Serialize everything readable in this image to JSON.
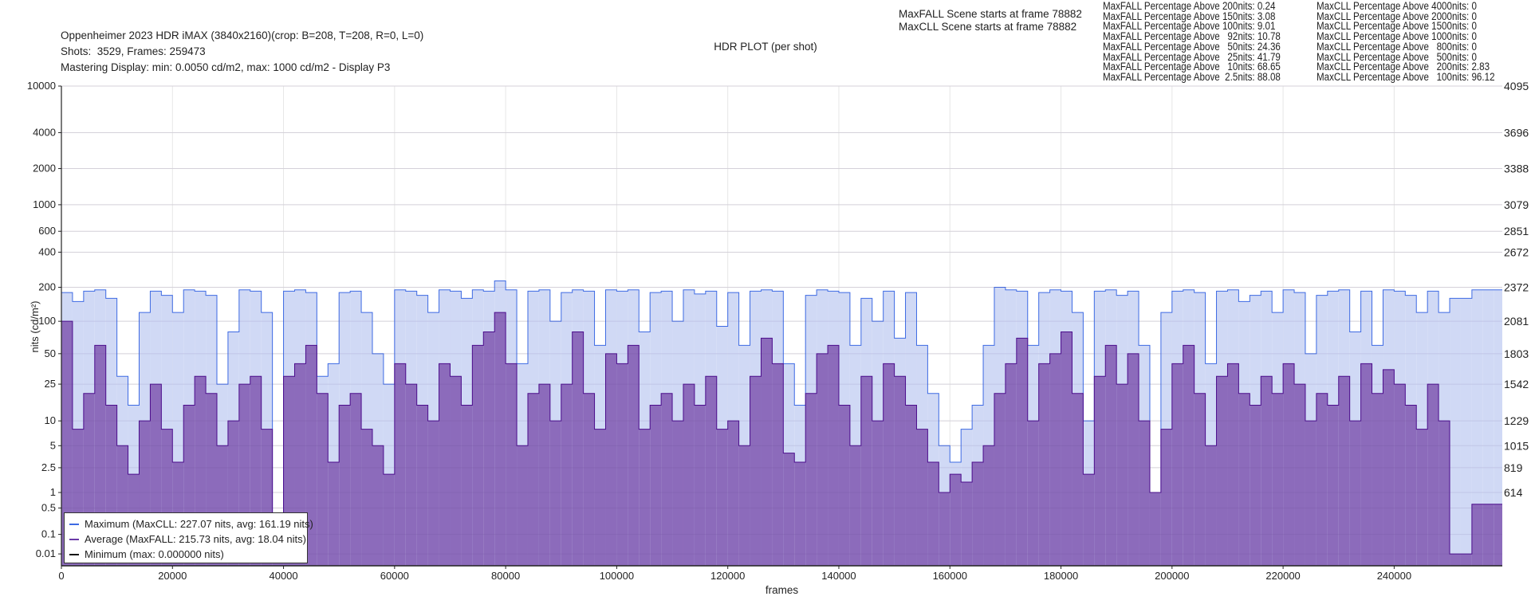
{
  "header": {
    "line1": "Oppenheimer 2023 HDR iMAX (3840x2160)(crop: B=208, T=208, R=0, L=0)",
    "line2": "Shots:  3529, Frames: 259473",
    "line3": "Mastering Display: min: 0.0050 cd/m2, max: 1000 cd/m2 - Display P3"
  },
  "scene_info": [
    "MaxFALL Scene starts at frame 78882",
    "MaxCLL Scene starts at frame 78882"
  ],
  "maxfall_stats": [
    "MaxFALL Percentage Above 200nits: 0.24",
    "MaxFALL Percentage Above 150nits: 3.08",
    "MaxFALL Percentage Above 100nits: 9.01",
    "MaxFALL Percentage Above   92nits: 10.78",
    "MaxFALL Percentage Above   50nits: 24.36",
    "MaxFALL Percentage Above   25nits: 41.79",
    "MaxFALL Percentage Above   10nits: 68.65",
    "MaxFALL Percentage Above  2.5nits: 88.08"
  ],
  "maxcll_stats": [
    "MaxCLL Percentage Above 4000nits: 0",
    "MaxCLL Percentage Above 2000nits: 0",
    "MaxCLL Percentage Above 1500nits: 0",
    "MaxCLL Percentage Above 1000nits: 0",
    "MaxCLL Percentage Above   800nits: 0",
    "MaxCLL Percentage Above   500nits: 0",
    "MaxCLL Percentage Above   200nits: 2.83",
    "MaxCLL Percentage Above   100nits: 96.12"
  ],
  "chart_data": {
    "type": "area",
    "title": "HDR PLOT (per shot)",
    "xlabel": "frames",
    "ylabel": "nits (cd/m²)",
    "xlim": [
      0,
      259473
    ],
    "y_scale": "PQ (ST 2084)",
    "ylim_nits": [
      0,
      10000
    ],
    "grid": true,
    "xticks": [
      0,
      20000,
      40000,
      60000,
      80000,
      100000,
      120000,
      140000,
      160000,
      180000,
      200000,
      220000,
      240000
    ],
    "yticks_left": [
      {
        "nits": 10000,
        "label": "10000"
      },
      {
        "nits": 4000,
        "label": "4000"
      },
      {
        "nits": 2000,
        "label": "2000"
      },
      {
        "nits": 1000,
        "label": "1000"
      },
      {
        "nits": 600,
        "label": "600"
      },
      {
        "nits": 400,
        "label": "400"
      },
      {
        "nits": 200,
        "label": "200"
      },
      {
        "nits": 100,
        "label": "100"
      },
      {
        "nits": 50,
        "label": "50"
      },
      {
        "nits": 25,
        "label": "25"
      },
      {
        "nits": 10,
        "label": "10"
      },
      {
        "nits": 5,
        "label": "5"
      },
      {
        "nits": 2.5,
        "label": "2.5"
      },
      {
        "nits": 1,
        "label": "1"
      },
      {
        "nits": 0.5,
        "label": "0.5"
      },
      {
        "nits": 0.1,
        "label": "0.1"
      },
      {
        "nits": 0.01,
        "label": "0.01"
      }
    ],
    "yticks_right": [
      {
        "nits": 10000,
        "label": "4095"
      },
      {
        "nits": 4000,
        "label": "3696"
      },
      {
        "nits": 2000,
        "label": "3388"
      },
      {
        "nits": 1000,
        "label": "3079"
      },
      {
        "nits": 600,
        "label": "2851"
      },
      {
        "nits": 400,
        "label": "2672"
      },
      {
        "nits": 200,
        "label": "2372"
      },
      {
        "nits": 100,
        "label": "2081"
      },
      {
        "nits": 50,
        "label": "1803"
      },
      {
        "nits": 25,
        "label": "1542"
      },
      {
        "nits": 10,
        "label": "1229"
      },
      {
        "nits": 5,
        "label": "1015"
      },
      {
        "nits": 2.5,
        "label": "819"
      },
      {
        "nits": 1,
        "label": "614"
      }
    ],
    "x_start": 0,
    "x_step": 2000,
    "series": [
      {
        "name": "Maximum (MaxCLL: 227.07 nits, avg: 161.19 nits)",
        "color": "#3d6ae3",
        "fill": "#d0d9f5",
        "values": [
          180,
          150,
          185,
          190,
          160,
          30,
          15,
          120,
          185,
          170,
          120,
          190,
          185,
          170,
          25,
          80,
          190,
          185,
          120,
          0.3,
          185,
          190,
          180,
          30,
          40,
          180,
          185,
          120,
          50,
          25,
          190,
          185,
          170,
          120,
          190,
          185,
          160,
          190,
          185,
          227,
          190,
          40,
          185,
          190,
          100,
          180,
          190,
          185,
          60,
          190,
          185,
          190,
          80,
          180,
          185,
          100,
          190,
          175,
          185,
          90,
          180,
          60,
          185,
          190,
          185,
          40,
          15,
          170,
          190,
          185,
          180,
          60,
          160,
          100,
          185,
          70,
          180,
          60,
          20,
          5,
          3,
          8,
          15,
          60,
          200,
          190,
          185,
          60,
          180,
          190,
          185,
          120,
          10,
          185,
          190,
          170,
          185,
          60,
          1,
          120,
          185,
          190,
          180,
          40,
          185,
          190,
          150,
          170,
          185,
          120,
          190,
          180,
          50,
          170,
          185,
          190,
          80,
          185,
          60,
          190,
          185,
          170,
          120,
          185,
          120,
          160,
          160,
          190,
          190,
          190
        ]
      },
      {
        "name": "Average (MaxFALL: 215.73 nits, avg: 18.04 nits)",
        "color": "#4b0c8c",
        "fill": "#8c6bbb",
        "values": [
          100,
          8,
          20,
          60,
          15,
          5,
          2,
          10,
          25,
          8,
          3,
          15,
          30,
          20,
          5,
          10,
          25,
          30,
          8,
          0.3,
          30,
          40,
          60,
          20,
          3,
          15,
          20,
          8,
          5,
          2,
          40,
          25,
          15,
          10,
          40,
          30,
          15,
          60,
          80,
          120,
          40,
          5,
          20,
          25,
          10,
          25,
          80,
          20,
          8,
          50,
          40,
          60,
          8,
          15,
          20,
          10,
          25,
          15,
          30,
          8,
          10,
          5,
          30,
          70,
          40,
          4,
          3,
          20,
          50,
          60,
          15,
          5,
          30,
          10,
          40,
          30,
          15,
          8,
          3,
          1,
          2,
          1.5,
          3,
          5,
          20,
          40,
          70,
          10,
          40,
          50,
          80,
          20,
          2,
          30,
          60,
          25,
          50,
          10,
          1,
          8,
          40,
          60,
          20,
          5,
          30,
          40,
          20,
          15,
          30,
          20,
          40,
          25,
          10,
          20,
          15,
          30,
          10,
          40,
          20,
          35,
          25,
          15,
          8,
          25,
          10,
          0.01,
          0.01,
          0.6,
          0.6,
          0.6
        ]
      },
      {
        "name": "Minimum (max: 0.000000 nits)",
        "color": "#111111",
        "values": []
      }
    ],
    "legend": {
      "position": "bottom-left"
    }
  }
}
